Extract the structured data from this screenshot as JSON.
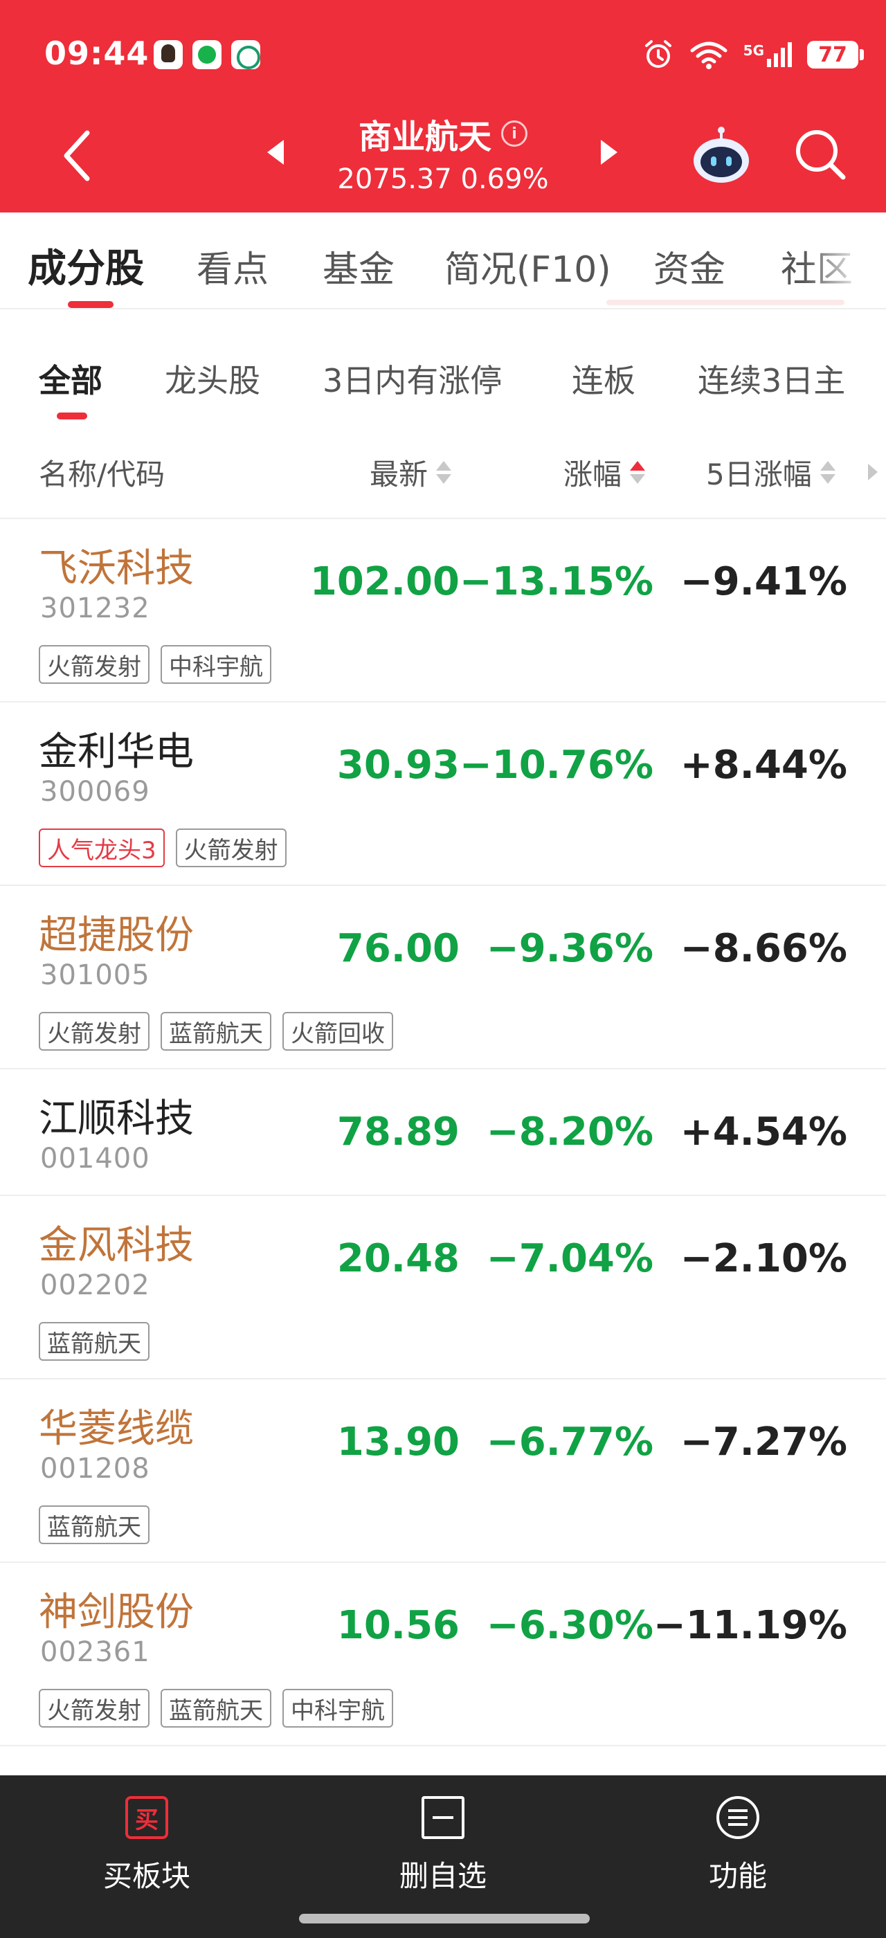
{
  "status_bar": {
    "time": "09:44",
    "network": "5G",
    "battery": "77"
  },
  "header": {
    "title": "商业航天",
    "subtitle": "2075.37 0.69%",
    "info_symbol": "i"
  },
  "main_tabs": [
    "成分股",
    "看点",
    "基金",
    "简况(F10)",
    "资金",
    "社区"
  ],
  "sub_tabs": [
    "全部",
    "龙头股",
    "3日内有涨停",
    "连板",
    "连续3日主"
  ],
  "columns": {
    "name": "名称/代码",
    "latest": "最新",
    "change": "涨幅",
    "change5": "5日涨幅"
  },
  "stocks": [
    {
      "name": "飞沃科技",
      "code": "301232",
      "price": "102.00",
      "change": "−13.15%",
      "change5": "−9.41%",
      "tags": [
        "火箭发射",
        "中科宇航"
      ]
    },
    {
      "name": "金利华电",
      "code": "300069",
      "price": "30.93",
      "change": "−10.76%",
      "change5": "+8.44%",
      "tags": [
        "人气龙头3",
        "火箭发射"
      ]
    },
    {
      "name": "超捷股份",
      "code": "301005",
      "price": "76.00",
      "change": "−9.36%",
      "change5": "−8.66%",
      "tags": [
        "火箭发射",
        "蓝箭航天",
        "火箭回收"
      ]
    },
    {
      "name": "江顺科技",
      "code": "001400",
      "price": "78.89",
      "change": "−8.20%",
      "change5": "+4.54%",
      "tags": []
    },
    {
      "name": "金风科技",
      "code": "002202",
      "price": "20.48",
      "change": "−7.04%",
      "change5": "−2.10%",
      "tags": [
        "蓝箭航天"
      ]
    },
    {
      "name": "华菱线缆",
      "code": "001208",
      "price": "13.90",
      "change": "−6.77%",
      "change5": "−7.27%",
      "tags": [
        "蓝箭航天"
      ]
    },
    {
      "name": "神剑股份",
      "code": "002361",
      "price": "10.56",
      "change": "−6.30%",
      "change5": "−11.19%",
      "tags": [
        "火箭发射",
        "蓝箭航天",
        "中科宇航"
      ]
    }
  ],
  "bottom_bar": {
    "buy_icon": "买",
    "buy": "买板块",
    "delete": "删自选",
    "func": "功能"
  },
  "colors": {
    "header_red": "#ee2e3a",
    "down_green": "#10a244",
    "name_orange": "#c0743a",
    "hot_tag_red": "#e43b45",
    "bottom_bg": "#262626"
  },
  "icons": [
    "back-arrow-icon",
    "prev-triangle-icon",
    "next-triangle-icon",
    "info-icon",
    "robot-assistant-icon",
    "search-icon",
    "sort-icon",
    "buy-icon",
    "delete-favorite-icon",
    "function-menu-icon"
  ]
}
